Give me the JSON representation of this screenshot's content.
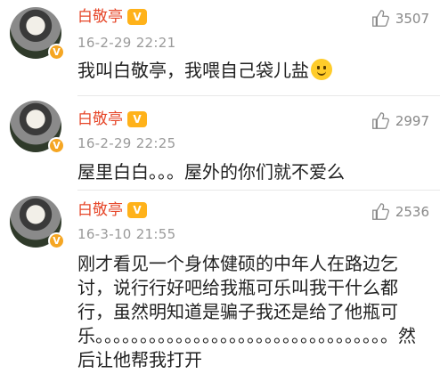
{
  "comments": [
    {
      "username": "白敬亭",
      "timestamp": "16-2-29 22:21",
      "likes": "3507",
      "text": "我叫白敬亭，我喂自己袋儿盐",
      "has_emoji": true
    },
    {
      "username": "白敬亭",
      "timestamp": "16-2-29 22:25",
      "likes": "2997",
      "text": "屋里白白。。。屋外的你们就不爱么",
      "has_emoji": false
    },
    {
      "username": "白敬亭",
      "timestamp": "16-3-10 21:55",
      "likes": "2536",
      "text": "刚才看见一个身体健硕的中年人在路边乞讨，说行行好吧给我瓶可乐叫我干什么都行，虽然明知道是骗子我还是给了他瓶可乐。。。。。。。。。。。。。。。。。。。。。。。。。。。。。。。。。然后让他帮我打开",
      "has_emoji": false
    }
  ],
  "badges": {
    "vip_icon": "vip-crown-icon",
    "verified_icon": "verified-v-icon"
  },
  "colors": {
    "username": "#e6472a",
    "text": "#222222",
    "meta": "#9a9a9a",
    "badge": "#ffb21a"
  }
}
